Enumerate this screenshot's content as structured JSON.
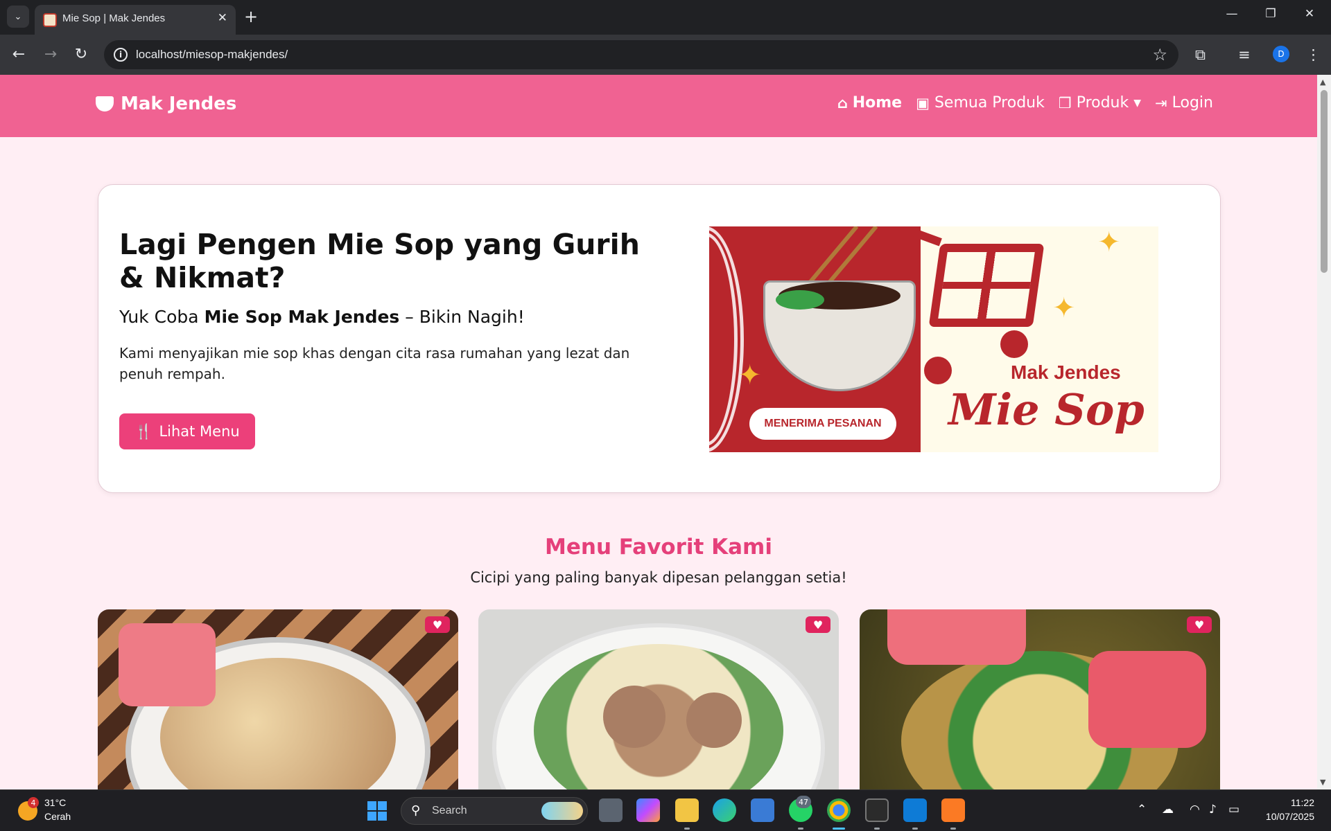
{
  "browser": {
    "tab_title": "Mie Sop | Mak Jendes",
    "url": "localhost/miesop-makjendes/",
    "profile_initial": "D"
  },
  "navbar": {
    "brand": "Mak Jendes",
    "links": [
      "Home",
      "Semua Produk",
      "Produk",
      "Login"
    ],
    "active": "Home"
  },
  "hero": {
    "title": "Lagi Pengen Mie Sop yang Gurih & Nikmat?",
    "subtitle_pre": "Yuk Coba ",
    "subtitle_bold": "Mie Sop Mak Jendes",
    "subtitle_post": " – Bikin Nagih!",
    "description": "Kami menyajikan mie sop khas dengan cita rasa rumahan yang lezat dan penuh rempah.",
    "button": "Lihat Menu",
    "banner": {
      "order_label": "MENERIMA PESANAN",
      "brand_small": "Mak Jendes",
      "brand_big": "Mie Sop"
    }
  },
  "favorites": {
    "title": "Menu Favorit Kami",
    "subtitle": "Cicipi yang paling banyak dipesan pelanggan setia!",
    "cards": [
      {
        "image": "mie-sop-kerupuk-photo"
      },
      {
        "image": "mie-bakso-photo"
      },
      {
        "image": "mie-sop-kuah-photo"
      }
    ]
  },
  "taskbar": {
    "weather_temp": "31°C",
    "weather_condition": "Cerah",
    "weather_badge": "4",
    "search_placeholder": "Search",
    "whatsapp_badge": "47",
    "time": "11:22",
    "date": "10/07/2025"
  },
  "colors": {
    "navbar": "#f06292",
    "accent": "#ec407a",
    "page_bg": "#ffeef4",
    "section_title": "#e5407a"
  }
}
